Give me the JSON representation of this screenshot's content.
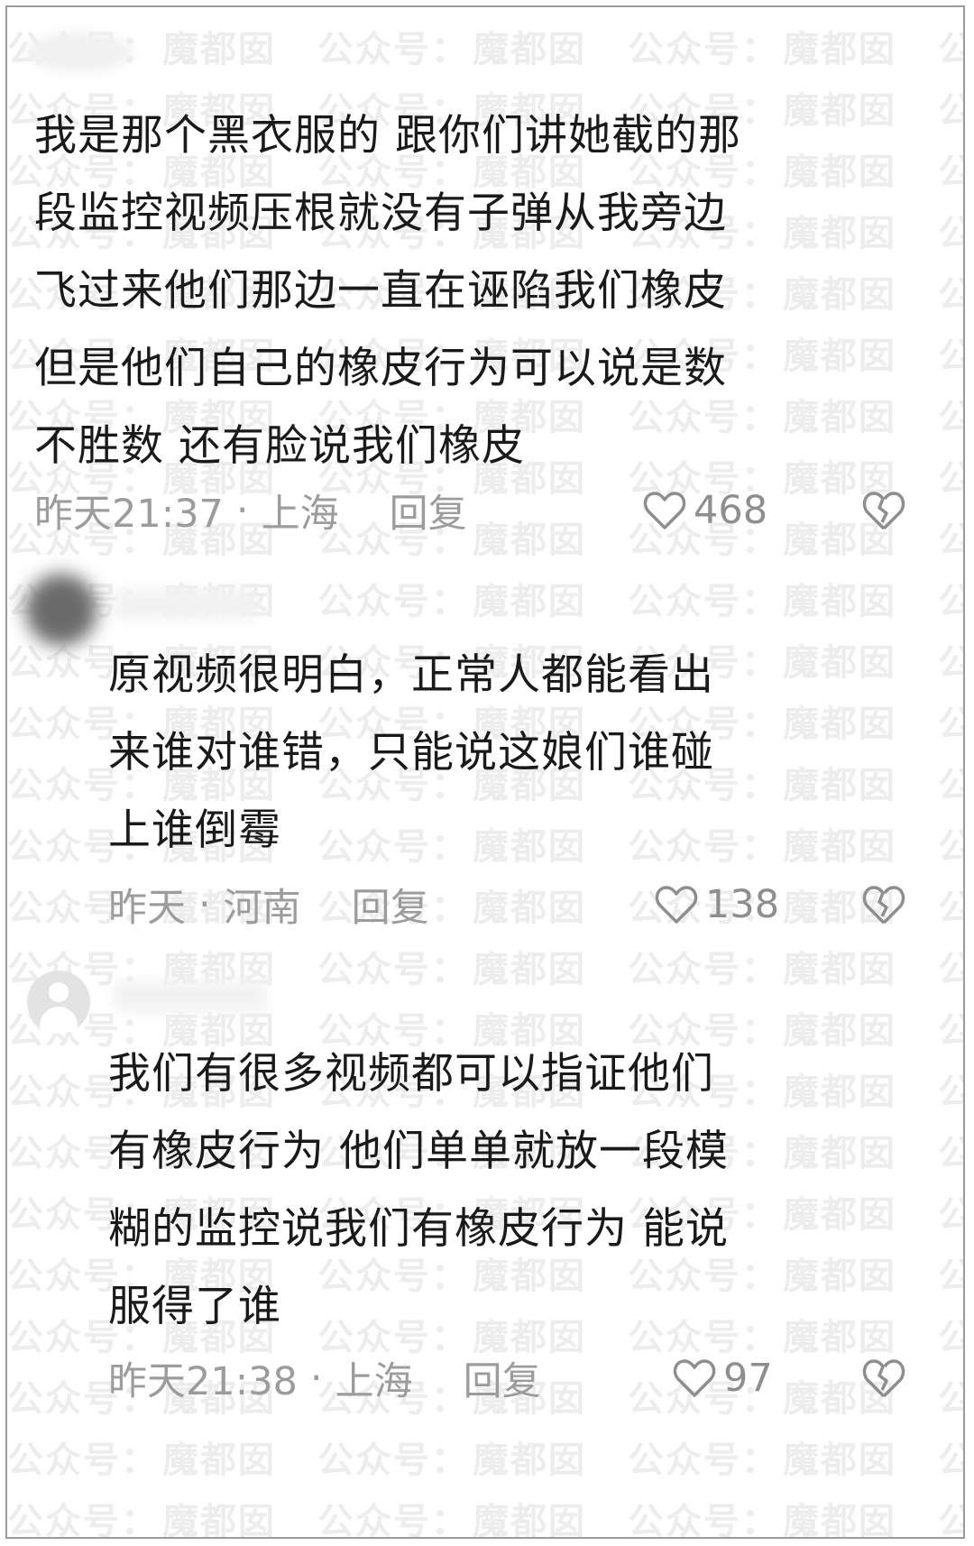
{
  "watermark": {
    "text_a": "公众号：",
    "text_b": "魔都囡"
  },
  "comments": [
    {
      "lines": [
        "我是那个黑衣服的 跟你们讲她截的那",
        "段监控视频压根就没有子弹从我旁边",
        "飞过来他们那边一直在诬陷我们橡皮",
        "但是他们自己的橡皮行为可以说是数",
        "不胜数 还有脸说我们橡皮"
      ],
      "time": "昨天21:37",
      "separator": "·",
      "location": "上海",
      "reply_label": "回复",
      "likes": "468"
    },
    {
      "lines": [
        "原视频很明白，正常人都能看出",
        "来谁对谁错，只能说这娘们谁碰",
        "上谁倒霉"
      ],
      "time": "昨天",
      "separator": "·",
      "location": "河南",
      "reply_label": "回复",
      "likes": "138"
    },
    {
      "lines": [
        "我们有很多视频都可以指证他们",
        "有橡皮行为 他们单单就放一段模",
        "糊的监控说我们有橡皮行为 能说",
        "服得了谁"
      ],
      "time": "昨天21:38",
      "separator": "·",
      "location": "上海",
      "reply_label": "回复",
      "likes": "97"
    }
  ],
  "icons": {
    "like": "heart-outline-icon",
    "dislike": "broken-heart-icon",
    "avatar_default": "default-user-avatar-icon"
  },
  "colors": {
    "text": "#1a1a1a",
    "meta": "#9c9c9c",
    "icon": "#8e8e8e",
    "border": "#9a9a9a"
  }
}
